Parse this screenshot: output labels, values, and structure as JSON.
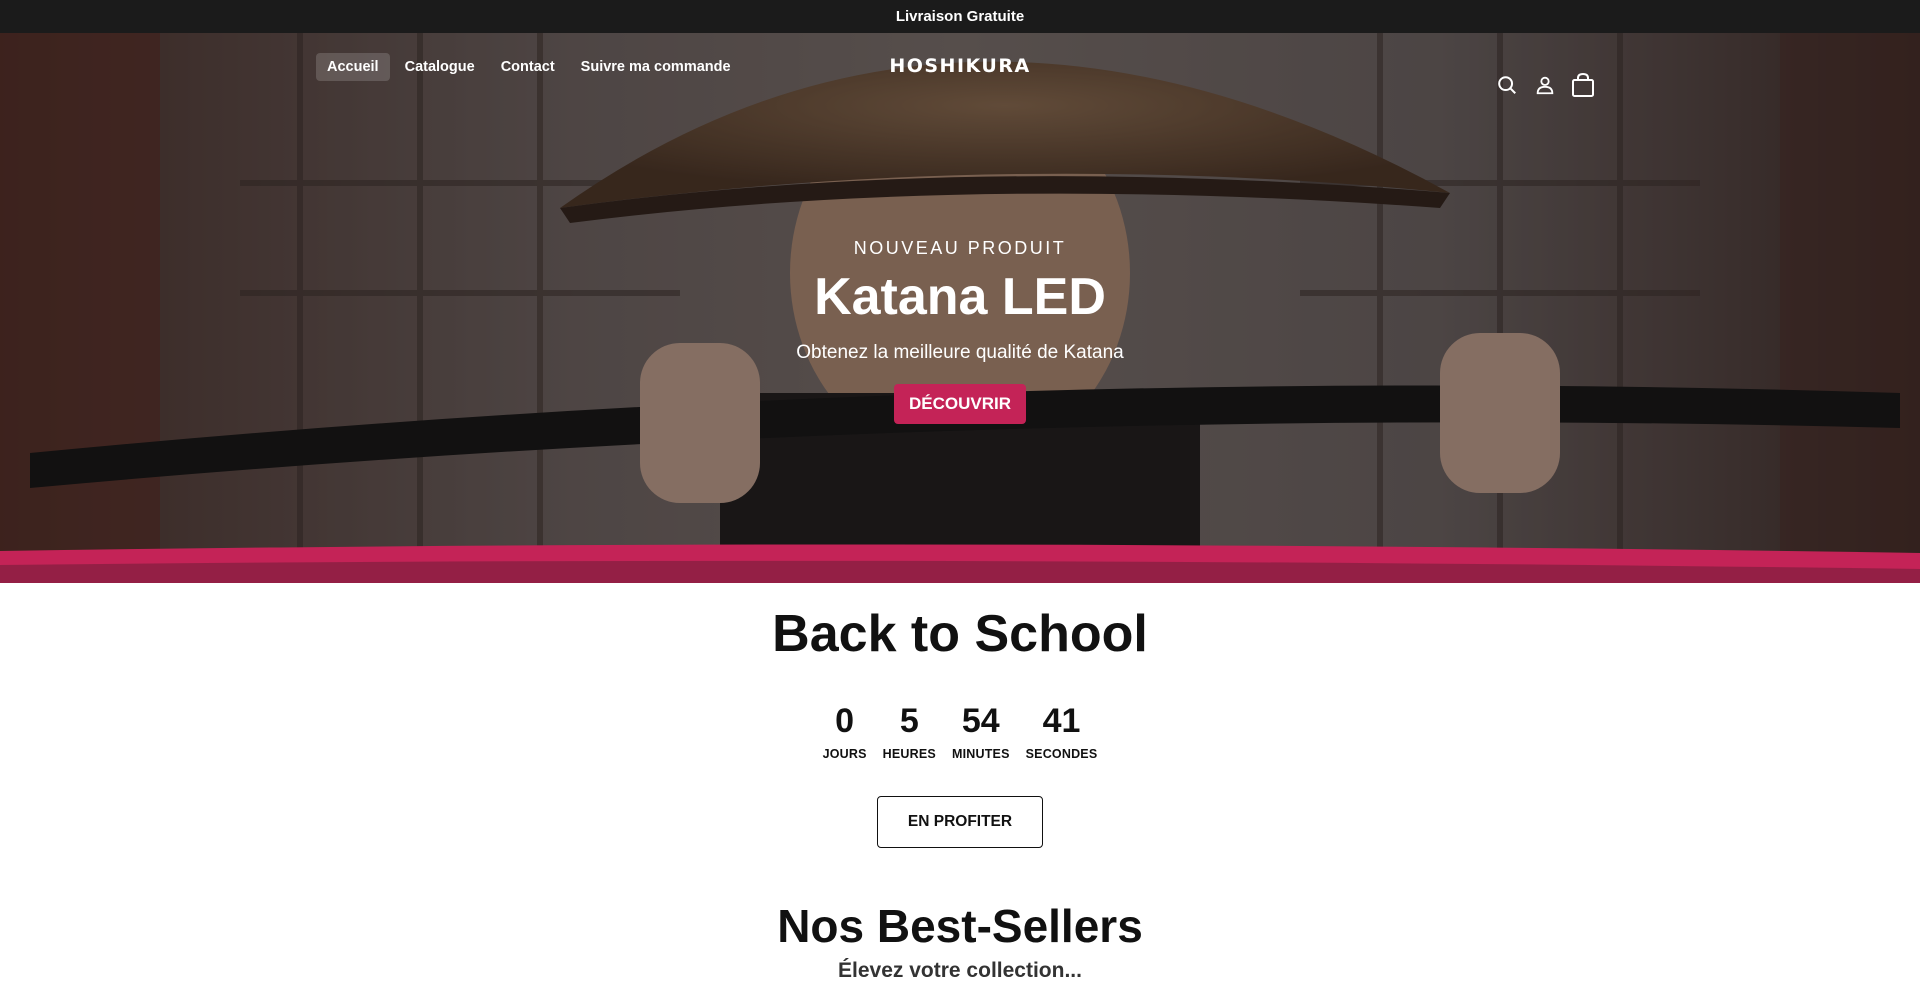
{
  "announcement": "Livraison Gratuite",
  "nav": {
    "links": [
      "Accueil",
      "Catalogue",
      "Contact",
      "Suivre ma commande"
    ],
    "active": "Accueil",
    "logo": "HOSHIKURA"
  },
  "hero": {
    "eyebrow": "NOUVEAU PRODUIT",
    "title": "Katana LED",
    "subtitle": "Obtenez la meilleure qualité de Katana",
    "cta": "DÉCOUVRIR"
  },
  "promo": {
    "title": "Back to School",
    "countdown": [
      {
        "value": "0",
        "label": "JOURS"
      },
      {
        "value": "5",
        "label": "HEURES"
      },
      {
        "value": "54",
        "label": "MINUTES"
      },
      {
        "value": "41",
        "label": "SECONDES"
      }
    ],
    "button": "EN PROFITER"
  },
  "bestsellers": {
    "title": "Nos Best-Sellers",
    "subtitle": "Élevez votre collection..."
  },
  "colors": {
    "accent": "#c42357",
    "announcement_bg": "#1b1b1b",
    "wave_dark": "#3b1a26"
  },
  "icons": [
    "search-icon",
    "account-icon",
    "cart-icon"
  ]
}
